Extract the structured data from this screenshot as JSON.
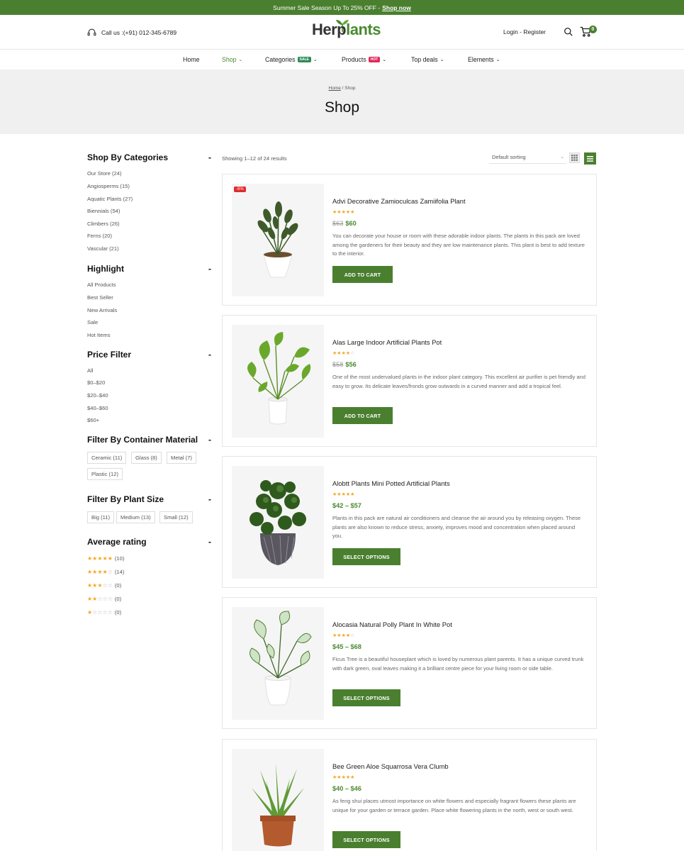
{
  "topbar": {
    "text": "Summer Sale Season Up To 25% OFF -",
    "link": "Shop now"
  },
  "header": {
    "call": "Call us :(+91) 012-345-6789",
    "logo_a": "Herp",
    "logo_b": "lants",
    "account": "Login - Register",
    "cart_count": "0"
  },
  "nav": {
    "items": [
      {
        "label": "Home"
      },
      {
        "label": "Shop"
      },
      {
        "label": "Categories",
        "tag": "SALE"
      },
      {
        "label": "Products",
        "tag": "HOT"
      },
      {
        "label": "Top deals"
      },
      {
        "label": "Elements"
      }
    ]
  },
  "banner": {
    "crumb_home": "Home",
    "crumb_current": "/ Shop",
    "title": "Shop"
  },
  "sidebar": {
    "categories": {
      "title": "Shop By Categories",
      "items": [
        "Our Store (24)",
        "Angiosperms (15)",
        "Aquatic Plants (27)",
        "Biennials (54)",
        "Climbers (26)",
        "Ferns (20)",
        "Vascular (21)"
      ]
    },
    "highlight": {
      "title": "Highlight",
      "items": [
        "All Products",
        "Best Seller",
        "New Arrivals",
        "Sale",
        "Hot Items"
      ]
    },
    "price": {
      "title": "Price Filter",
      "items": [
        "All",
        "$0–$20",
        "$20–$40",
        "$40–$60",
        "$60+"
      ]
    },
    "material": {
      "title": "Filter By Container Material",
      "items": [
        "Ceramic (11)",
        "Glass (8)",
        "Metal (7)",
        "Plastic (12)"
      ]
    },
    "size": {
      "title": "Filter By Plant Size",
      "items": [
        "Big (11)",
        "Medium (13)",
        "Small (12)"
      ]
    },
    "rating": {
      "title": "Average rating",
      "items": [
        {
          "stars": 5,
          "count": "(10)"
        },
        {
          "stars": 4,
          "count": "(14)"
        },
        {
          "stars": 3,
          "count": "(0)"
        },
        {
          "stars": 2,
          "count": "(0)"
        },
        {
          "stars": 1,
          "count": "(0)"
        }
      ]
    }
  },
  "toolbar": {
    "results": "Showing 1–12 of 24 results",
    "sorting": "Default sorting"
  },
  "products": [
    {
      "name": "Advi Decorative Zamioculcas Zamiifolia Plant",
      "rating": 5,
      "old_price": "$63",
      "price": "$60",
      "badge": "-5%",
      "desc": "You can decorate your house or room with these adorable indoor plants. The plants in this pack are loved among the gardeners for their beauty and they are low maintenance plants. This plant is best to add texture to the interior.",
      "button": "ADD TO CART"
    },
    {
      "name": "Alas Large Indoor Artificial Plants Pot",
      "rating": 4,
      "old_price": "$58",
      "price": "$56",
      "desc": "One of the most undervalued plants in the indoor plant category. This excellent air purifier is pet friendly and easy to grow. Its delicate leaves/fronds grow outwards in a curved manner and add a tropical feel.",
      "button": "ADD TO CART"
    },
    {
      "name": "Alobtt Plants Mini Potted Artificial Plants",
      "rating": 5,
      "price": "$42 – $57",
      "desc": "Plants in this pack are natural air conditioners and cleanse the air around you by releasing oxygen. These plants are also known to reduce stress, anxiety, improves mood and concentration when placed around you.",
      "button": "SELECT OPTIONS"
    },
    {
      "name": "Alocasia Natural Polly Plant In White Pot",
      "rating": 4,
      "price": "$45 – $68",
      "desc": "Ficus Tree is a beautiful houseplant which is loved by numerous plant parents. It has a unique curved trunk with dark green, oval leaves making it a brilliant centre piece for your living room or side table.",
      "button": "SELECT OPTIONS"
    },
    {
      "name": "Bee Green Aloe Squarrosa Vera Clumb",
      "rating": 5,
      "price": "$40 – $46",
      "desc": "As feng shui places utmost importance on white flowers and especially fragrant flowers these plants are unique for your garden or terrace garden. Place white flowering plants in the north, west or south west.",
      "button": "SELECT OPTIONS"
    }
  ],
  "colors": {
    "brand": "#4a7f2f",
    "accent_green": "#4a8a2f",
    "star": "#f5a623",
    "sale_badge": "#e02b2b"
  }
}
